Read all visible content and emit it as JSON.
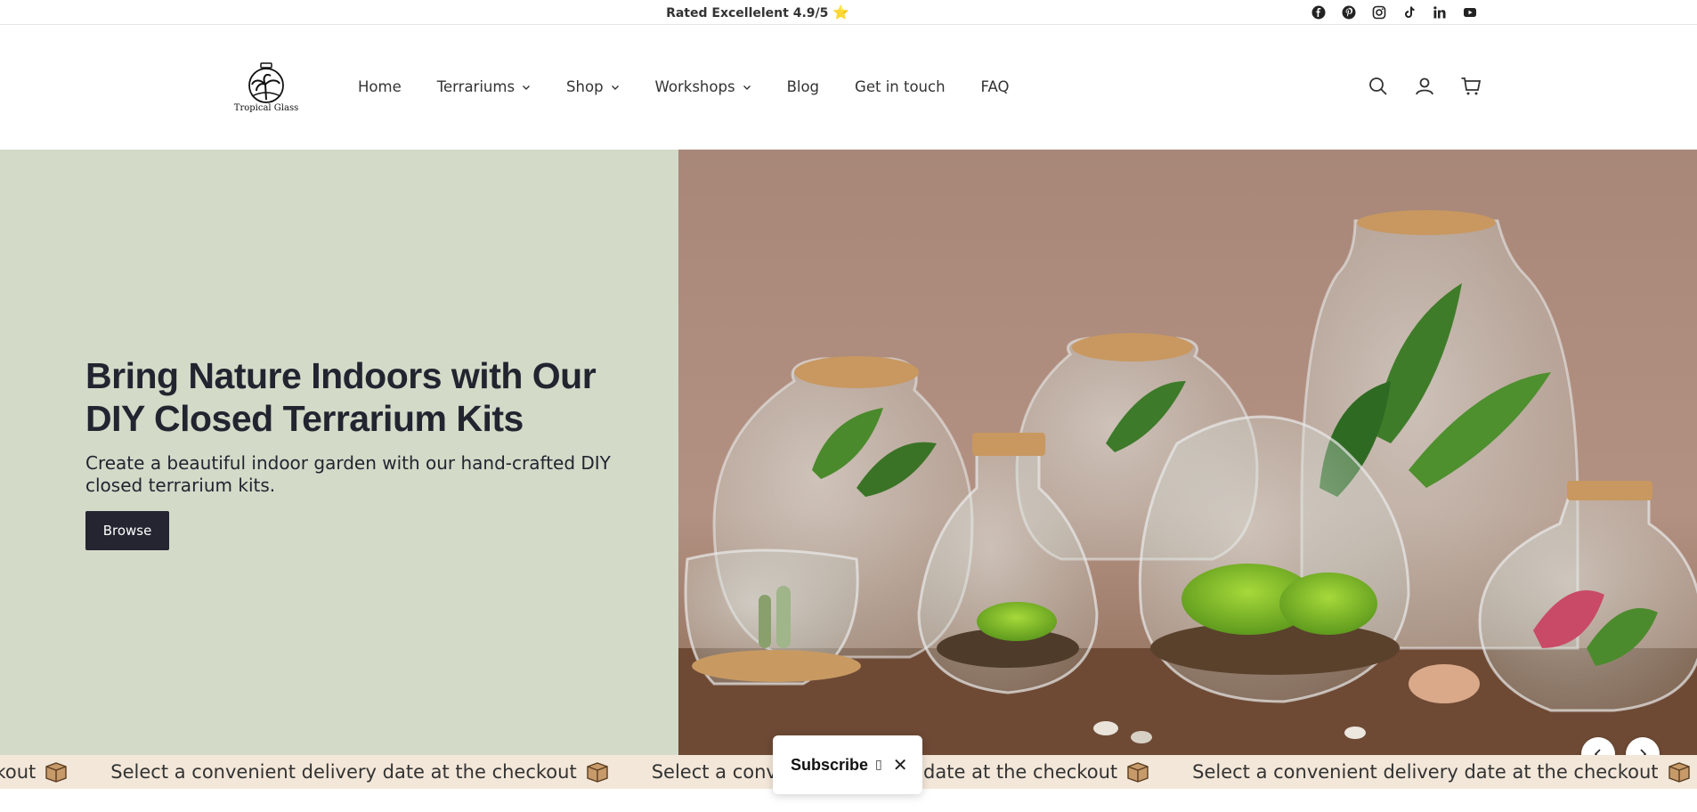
{
  "announcement": {
    "rating_text": "Rated Excellelent 4.9/5",
    "star_glyph": "⭐"
  },
  "socials": [
    "facebook-icon",
    "pinterest-icon",
    "instagram-icon",
    "tiktok-icon",
    "linkedin-icon",
    "youtube-icon"
  ],
  "logo": {
    "text": "Tropical Glass"
  },
  "nav": {
    "items": [
      {
        "label": "Home",
        "has_dropdown": false
      },
      {
        "label": "Terrariums",
        "has_dropdown": true
      },
      {
        "label": "Shop",
        "has_dropdown": true
      },
      {
        "label": "Workshops",
        "has_dropdown": true
      },
      {
        "label": "Blog",
        "has_dropdown": false
      },
      {
        "label": "Get in touch",
        "has_dropdown": false
      },
      {
        "label": "FAQ",
        "has_dropdown": false
      }
    ]
  },
  "header_icons": [
    "search-icon",
    "account-icon",
    "cart-icon"
  ],
  "hero": {
    "title": "Bring Nature Indoors with Our DIY Closed Terrarium Kits",
    "subtitle": "Create a beautiful indoor garden with our hand-crafted DIY closed terrarium kits.",
    "button_label": "Browse",
    "left_bg": "#d3dac8",
    "button_bg": "#242530"
  },
  "marquee": {
    "items": [
      "eckout",
      "Select a convenient delivery date at the checkout",
      "Select a convenient delivery date at the checkout",
      "Select a convenient delivery date at the checkout"
    ],
    "bg": "#f3e7d9"
  },
  "subscribe": {
    "label": "Subscribe",
    "glyph": "▯",
    "close": "✕"
  }
}
